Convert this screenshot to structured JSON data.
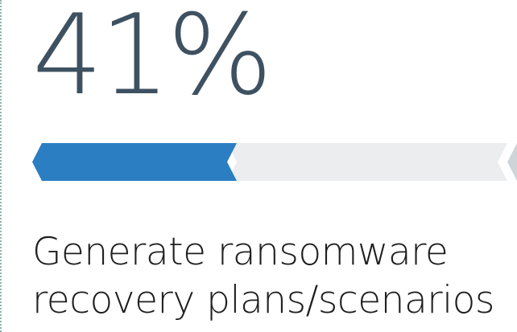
{
  "stat": {
    "value_text": "41%",
    "progress_fraction": 0.41,
    "label_lines": [
      "Generate ransomware",
      "recovery plans/scenarios"
    ]
  },
  "colors": {
    "value_text": "#3d5161",
    "bar_fill": "#2b7ec2",
    "bar_track": "#ebedef",
    "bar_next_chevron": "#cfd4d8",
    "label_text": "#1f1f1f",
    "dotted_rule": "#8fb3ad"
  }
}
